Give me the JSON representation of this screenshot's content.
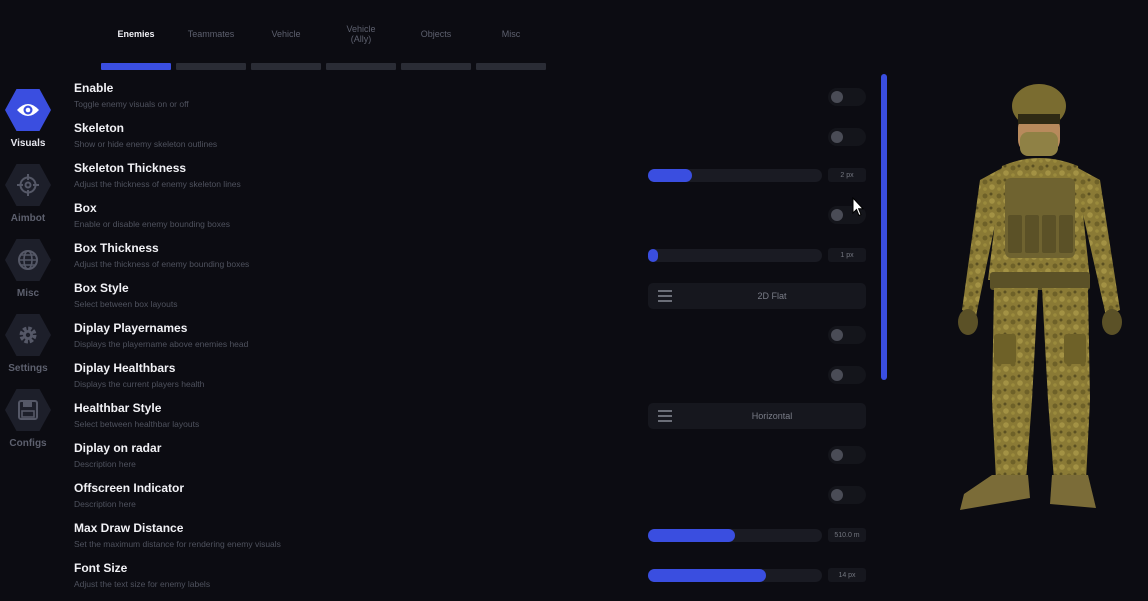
{
  "nav": {
    "items": [
      {
        "label": "Visuals",
        "icon": "eye-icon",
        "active": true
      },
      {
        "label": "Aimbot",
        "icon": "crosshair-icon",
        "active": false
      },
      {
        "label": "Misc",
        "icon": "globe-icon",
        "active": false
      },
      {
        "label": "Settings",
        "icon": "gear-icon",
        "active": false
      },
      {
        "label": "Configs",
        "icon": "save-icon",
        "active": false
      }
    ]
  },
  "tabs": [
    {
      "label": "Enemies",
      "active": true
    },
    {
      "label": "Teammates",
      "active": false
    },
    {
      "label": "Vehicle",
      "active": false
    },
    {
      "label": "Vehicle (Ally)",
      "active": false
    },
    {
      "label": "Objects",
      "active": false
    },
    {
      "label": "Misc",
      "active": false
    }
  ],
  "settings": {
    "enable": {
      "title": "Enable",
      "desc": "Toggle enemy visuals on or off",
      "state": false
    },
    "skeleton": {
      "title": "Skeleton",
      "desc": "Show or hide enemy skeleton outlines",
      "state": false
    },
    "skeleton_thickness": {
      "title": "Skeleton Thickness",
      "desc": "Adjust the thickness of enemy skeleton lines",
      "value": "2 px",
      "fill": 0.25
    },
    "box": {
      "title": "Box",
      "desc": "Enable or disable enemy bounding boxes",
      "state": false
    },
    "box_thickness": {
      "title": "Box Thickness",
      "desc": "Adjust the thickness of enemy bounding boxes",
      "value": "1 px",
      "fill": 0.03
    },
    "box_style": {
      "title": "Box Style",
      "desc": "Select between box layouts",
      "value": "2D Flat"
    },
    "display_playernames": {
      "title": "Diplay Playernames",
      "desc": "Displays the playername above enemies head",
      "state": false
    },
    "display_healthbars": {
      "title": "Diplay Healthbars",
      "desc": "Displays the current players health",
      "state": false
    },
    "healthbar_style": {
      "title": "Healthbar Style",
      "desc": "Select between healthbar layouts",
      "value": "Horizontal"
    },
    "display_on_radar": {
      "title": "Diplay on radar",
      "desc": "Description here",
      "state": false
    },
    "offscreen_indicator": {
      "title": "Offscreen Indicator",
      "desc": "Description here",
      "state": false
    },
    "max_draw_distance": {
      "title": "Max Draw Distance",
      "desc": "Set the maximum distance for rendering enemy visuals",
      "value": "510.0 m",
      "fill": 0.5
    },
    "font_size": {
      "title": "Font Size",
      "desc": "Adjust the text size for enemy labels",
      "value": "14 px",
      "fill": 0.68
    }
  },
  "colors": {
    "accent": "#3a4ee0",
    "background": "#0c0c12",
    "panel": "#16171e"
  },
  "preview": {
    "model": "soldier-preview"
  }
}
